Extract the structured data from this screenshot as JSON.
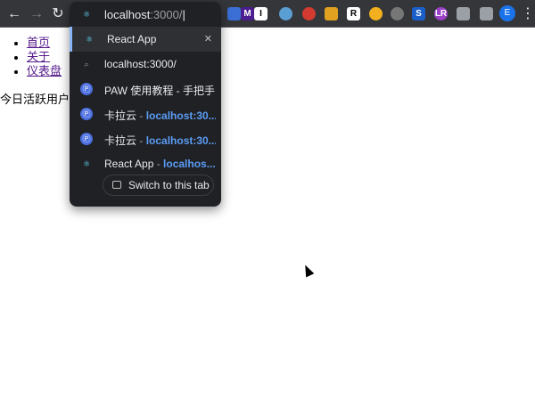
{
  "toolbar": {
    "back": "←",
    "forward": "→",
    "reload": "↻",
    "profile_initial": "E",
    "menu": "⋮",
    "extensions": [
      {
        "label": "",
        "color": "#3b6fd6"
      },
      {
        "label": "M",
        "color": "#4b1d8f"
      },
      {
        "label": "I",
        "color": "#ffffff"
      },
      {
        "label": "",
        "color": "#5a9fd4"
      },
      {
        "label": "",
        "color": "#d33b30"
      },
      {
        "label": "",
        "color": "#e0a020"
      },
      {
        "label": "R",
        "color": "#ffffff"
      },
      {
        "label": "",
        "color": "#f2b01e"
      },
      {
        "label": "",
        "color": "#777777"
      },
      {
        "label": "S",
        "color": "#1a5fc9"
      },
      {
        "label": "LR",
        "color": "#9c40c8"
      },
      {
        "label": "",
        "color": "#9aa0a6"
      },
      {
        "label": "",
        "color": "#9aa0a6"
      }
    ]
  },
  "omnibox": {
    "typed": "localhost",
    "completion": ":3000/"
  },
  "suggestions": [
    {
      "icon": "react-icon",
      "title": "React App",
      "url": "",
      "selected": true
    },
    {
      "icon": "search-icon",
      "title": "localhost:3000/",
      "url": ""
    },
    {
      "icon": "paw-icon",
      "title": "PAW 使用教程 - 手把手...",
      "url": ""
    },
    {
      "icon": "paw-icon",
      "title": "卡拉云",
      "sep": " - ",
      "url": "localhost:30..."
    },
    {
      "icon": "paw-icon",
      "title": "卡拉云",
      "sep": " - ",
      "url": "localhost:30..."
    },
    {
      "icon": "react-icon",
      "title": "React App",
      "sep": " - ",
      "url": "localhos..."
    }
  ],
  "switch_tab": "Switch to this tab",
  "page": {
    "links": [
      "首页",
      "关于",
      "仪表盘"
    ],
    "active_users": "今日活跃用户:"
  }
}
